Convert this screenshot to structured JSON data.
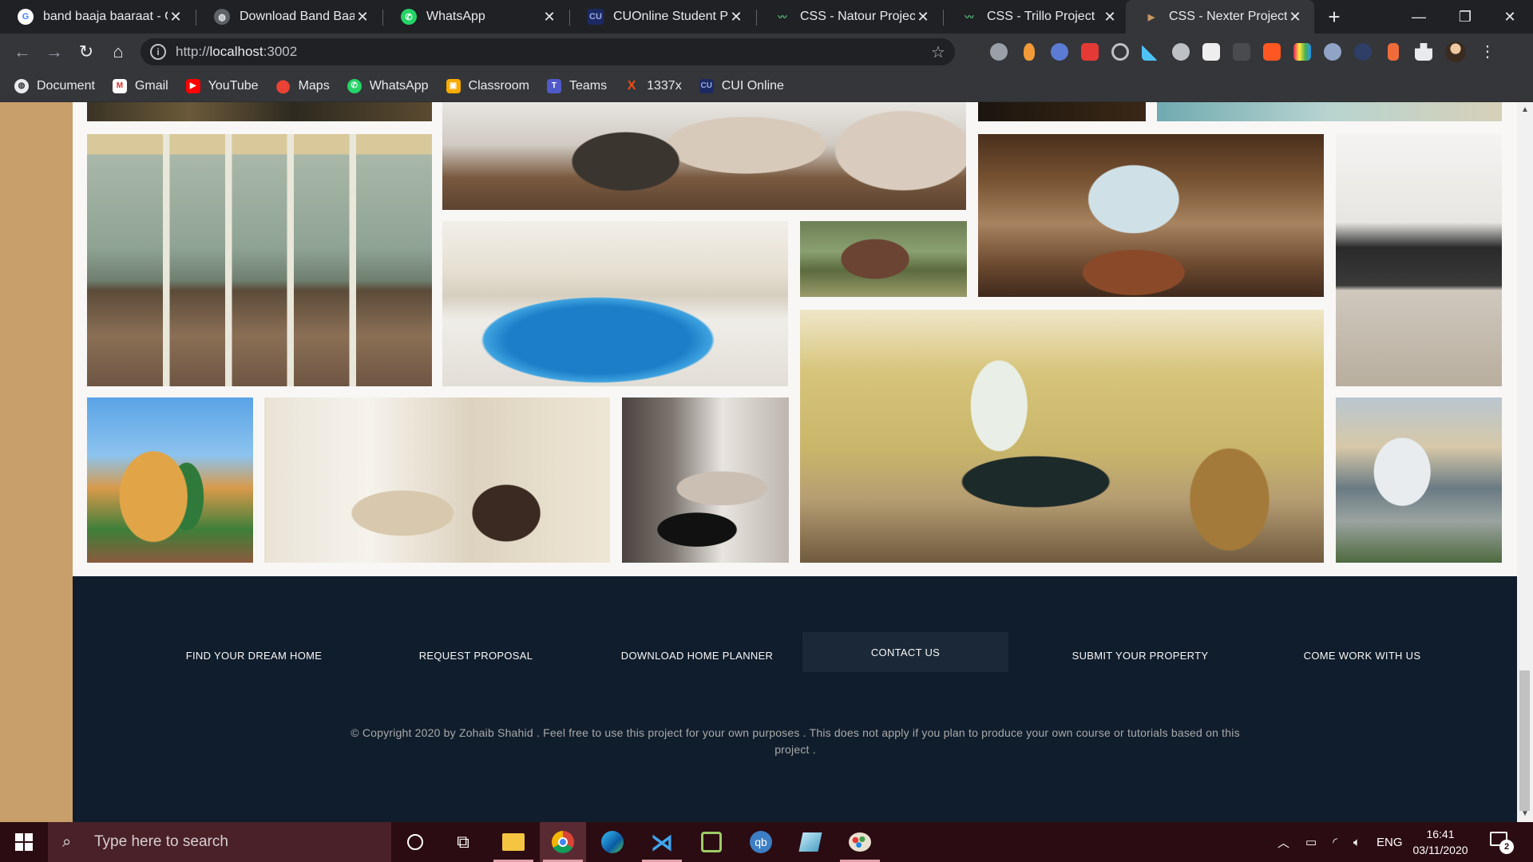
{
  "browser": {
    "tabs": [
      {
        "title": "band baaja baaraat - G",
        "favicon": "google-icon"
      },
      {
        "title": "Download Band Baaja B",
        "favicon": "globe-icon"
      },
      {
        "title": "WhatsApp",
        "favicon": "whatsapp-icon"
      },
      {
        "title": "CUOnline Student Port",
        "favicon": "cui-icon"
      },
      {
        "title": "CSS - Natour Project",
        "favicon": "natours-icon"
      },
      {
        "title": "CSS - Trillo Project",
        "favicon": "trillo-icon"
      },
      {
        "title": "CSS - Nexter Project",
        "favicon": "nexter-icon"
      }
    ],
    "active_tab": 6,
    "url_prefix": "http://",
    "url_host": "localhost",
    "url_suffix": ":3002",
    "bookmarks": [
      {
        "label": "Document",
        "icon": "globe-icon"
      },
      {
        "label": "Gmail",
        "icon": "gmail-icon"
      },
      {
        "label": "YouTube",
        "icon": "youtube-icon"
      },
      {
        "label": "Maps",
        "icon": "maps-icon"
      },
      {
        "label": "WhatsApp",
        "icon": "whatsapp-icon"
      },
      {
        "label": "Classroom",
        "icon": "classroom-icon"
      },
      {
        "label": "Teams",
        "icon": "teams-icon"
      },
      {
        "label": "1337x",
        "icon": "x-icon"
      },
      {
        "label": "CUI Online",
        "icon": "cui-icon"
      }
    ]
  },
  "footer": {
    "nav": [
      "Find your dream home",
      "Request proposal",
      "Download home planner",
      "Contact us",
      "Submit your property",
      "Come work with us"
    ],
    "copyright": "© Copyright 2020 by Zohaib Shahid . Feel free to use this project for your own purposes . This does not apply if you plan to produce your own course or tutorials based on this project ."
  },
  "taskbar": {
    "search_placeholder": "Type here to search",
    "language": "ENG",
    "time": "16:41",
    "date": "03/11/2020",
    "notifications": "2"
  },
  "colors": {
    "footer_bg": "#101d2c",
    "page_bg": "#f9f7f6",
    "side_bg": "#c89f6b",
    "taskbar_bg": "#2b0c12"
  }
}
